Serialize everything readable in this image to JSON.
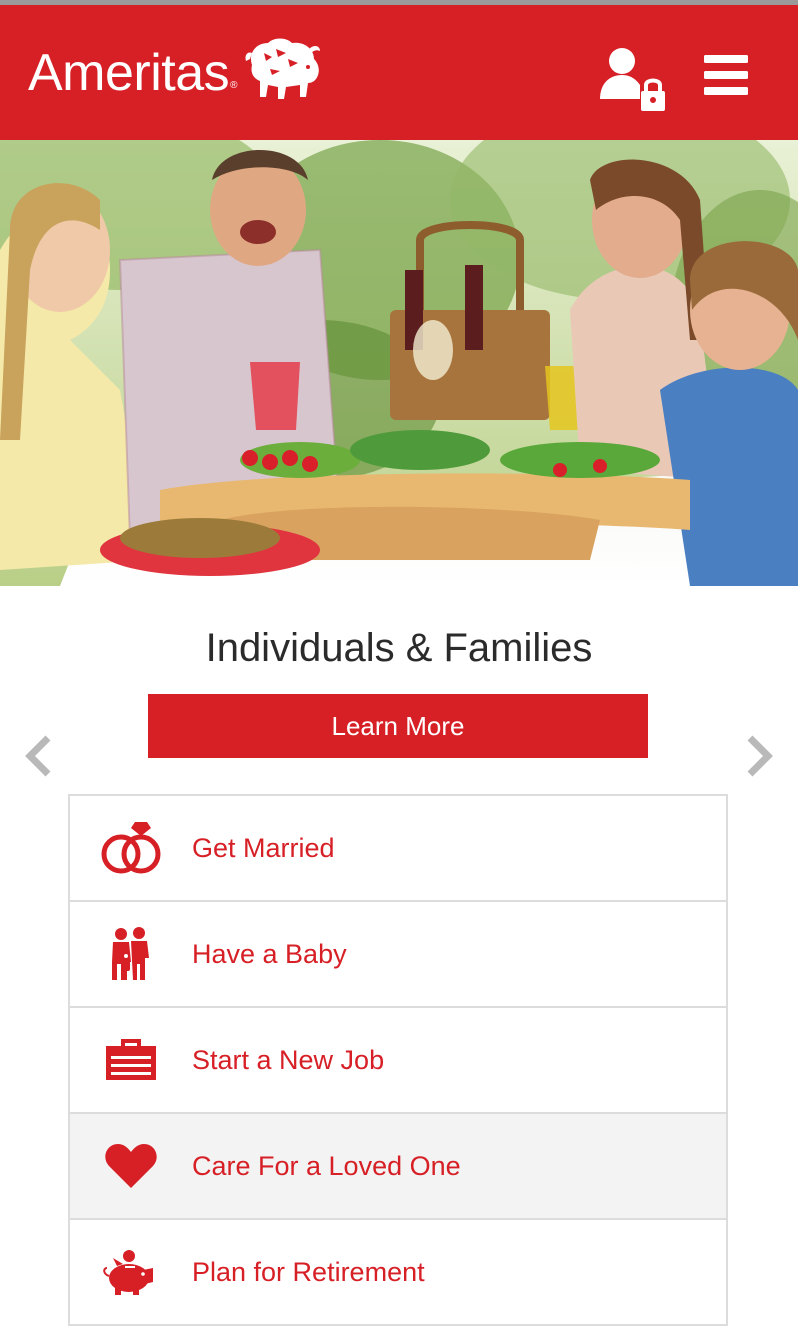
{
  "header": {
    "logo_text": "Ameritas",
    "logo_mark": "®",
    "brand_color": "#d71f26",
    "login_icon": "user-lock-icon",
    "menu_icon": "hamburger-menu-icon"
  },
  "hero": {
    "image": "family-picnic-photo"
  },
  "carousel": {
    "title": "Individuals & Families",
    "button_label": "Learn More",
    "prev_icon": "chevron-left-icon",
    "next_icon": "chevron-right-icon"
  },
  "life_events": [
    {
      "label": "Get Married",
      "icon": "wedding-rings-icon",
      "highlighted": false
    },
    {
      "label": "Have a Baby",
      "icon": "family-baby-icon",
      "highlighted": false
    },
    {
      "label": "Start a New Job",
      "icon": "briefcase-icon",
      "highlighted": false
    },
    {
      "label": "Care For a Loved One",
      "icon": "heart-icon",
      "highlighted": true
    },
    {
      "label": "Plan for Retirement",
      "icon": "piggy-bank-icon",
      "highlighted": false
    }
  ]
}
